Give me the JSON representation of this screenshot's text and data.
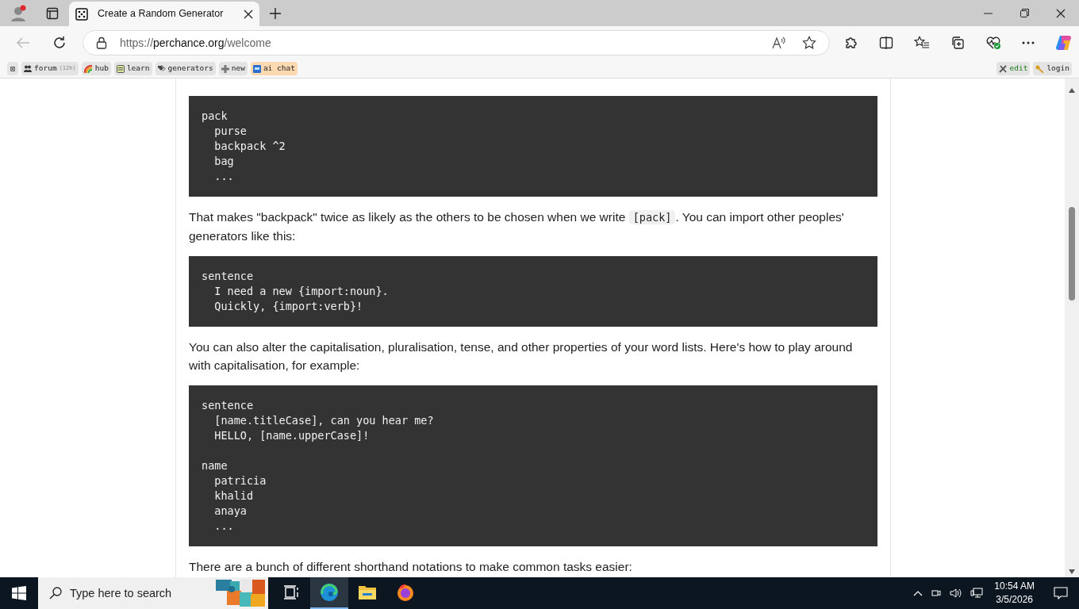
{
  "browser": {
    "tab": {
      "title": "Create a Random Generator",
      "selected": true
    },
    "url": {
      "scheme": "https://",
      "host": "perchance.org",
      "path": "/welcome"
    }
  },
  "bookmarks_left": [
    {
      "kind": "icon",
      "label": "⊠"
    },
    {
      "kind": "link",
      "label": "forum",
      "note": "(12h)"
    },
    {
      "kind": "link",
      "label": "hub"
    },
    {
      "kind": "link",
      "label": "learn"
    },
    {
      "kind": "link",
      "label": "generators"
    },
    {
      "kind": "link",
      "label": "new"
    },
    {
      "kind": "highlight",
      "label": "ai chat"
    }
  ],
  "bookmarks_right": [
    {
      "kind": "edit",
      "label": "edit"
    },
    {
      "kind": "link",
      "label": "login"
    }
  ],
  "content": [
    {
      "kind": "code",
      "lines": [
        "pack",
        "  purse",
        "  backpack ^2",
        "  bag",
        "  ..."
      ]
    },
    {
      "kind": "para",
      "parts": [
        {
          "kind": "text",
          "text": "That makes \"backpack\" twice as likely as the others to be chosen when we write "
        },
        {
          "kind": "code",
          "text": "[pack]"
        },
        {
          "kind": "text",
          "text": ". You can import other peoples' generators like this:"
        }
      ]
    },
    {
      "kind": "code",
      "lines": [
        "sentence",
        "  I need a new {import:noun}.",
        "  Quickly, {import:verb}!"
      ]
    },
    {
      "kind": "para",
      "parts": [
        {
          "kind": "text",
          "text": "You can also alter the capitalisation, pluralisation, tense, and other properties of your word lists. Here's how to play around with capitalisation, for example:"
        }
      ]
    },
    {
      "kind": "code",
      "groups": [
        [
          "sentence",
          "  [name.titleCase], can you hear me?",
          "  HELLO, [name.upperCase]!"
        ],
        [
          "name",
          "  patricia",
          "  khalid",
          "  anaya",
          "  ..."
        ]
      ]
    },
    {
      "kind": "para",
      "parts": [
        {
          "kind": "text",
          "text": "There are a bunch of different shorthand notations to make common tasks easier:"
        }
      ]
    }
  ],
  "taskbar": {
    "search_placeholder": "Type here to search",
    "apps": [
      {
        "kind": "taskview",
        "selected": false
      },
      {
        "kind": "edge",
        "selected": true
      },
      {
        "kind": "files",
        "selected": false
      },
      {
        "kind": "firefox",
        "selected": false
      }
    ],
    "time": "10:54 AM",
    "date": "3/5/2026"
  }
}
